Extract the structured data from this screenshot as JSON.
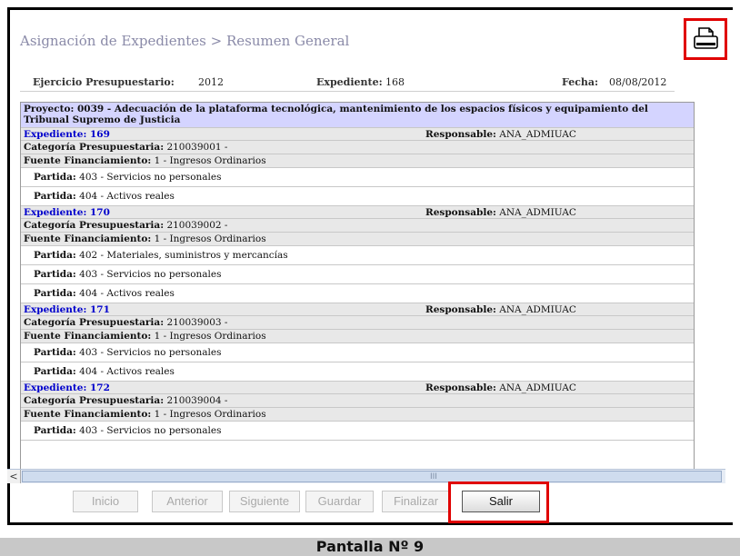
{
  "header": {
    "title": "Asignación de Expedientes > Resumen General",
    "print_icon": "printer-icon"
  },
  "meta": {
    "ejercicio_label": "Ejercicio Presupuestario:",
    "ejercicio_value": "2012",
    "expediente_label": "Expediente:",
    "expediente_value": "168",
    "fecha_label": "Fecha:",
    "fecha_value": "08/08/2012"
  },
  "grid": {
    "proyecto": "Proyecto: 0039 - Adecuación de la plataforma tecnológica, mantenimiento de los espacios físicos y equipamiento del Tribunal Supremo de Justicia",
    "responsable_label": "Responsable:",
    "categoria_label": "Categoría Presupuestaria:",
    "fuente_label": "Fuente Financiamiento:",
    "partida_label": "Partida:",
    "expedientes": [
      {
        "title": "Expediente: 169",
        "responsable": "ANA_ADMIUAC",
        "categoria": "210039001 -",
        "fuente": "1 - Ingresos Ordinarios",
        "partidas": [
          "403 - Servicios no personales",
          "404 - Activos reales"
        ]
      },
      {
        "title": "Expediente: 170",
        "responsable": "ANA_ADMIUAC",
        "categoria": "210039002 -",
        "fuente": "1 - Ingresos Ordinarios",
        "partidas": [
          "402 - Materiales, suministros y mercancías",
          "403 - Servicios no personales",
          "404 - Activos reales"
        ]
      },
      {
        "title": "Expediente: 171",
        "responsable": "ANA_ADMIUAC",
        "categoria": "210039003 -",
        "fuente": "1 - Ingresos Ordinarios",
        "partidas": [
          "403 - Servicios no personales",
          "404 - Activos reales"
        ]
      },
      {
        "title": "Expediente: 172",
        "responsable": "ANA_ADMIUAC",
        "categoria": "210039004 -",
        "fuente": "1 - Ingresos Ordinarios",
        "partidas": [
          "403 - Servicios no personales"
        ]
      }
    ]
  },
  "scrollbar": {
    "left_arrow": "<",
    "grip": "III"
  },
  "toolbar": {
    "inicio": "Inicio",
    "anterior": "Anterior",
    "siguiente": "Siguiente",
    "guardar": "Guardar",
    "finalizar": "Finalizar",
    "salir": "Salir"
  },
  "caption": "Pantalla Nº 9",
  "colors": {
    "highlight": "#e00000",
    "project_row": "#d4d4ff",
    "link": "#0000cc"
  }
}
